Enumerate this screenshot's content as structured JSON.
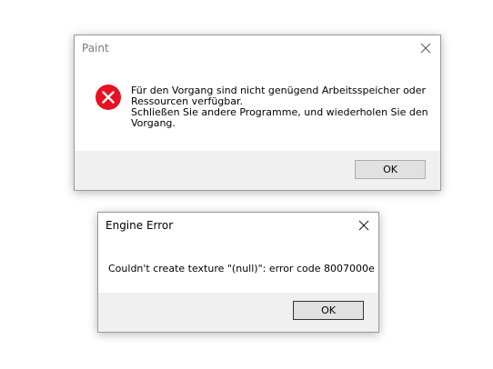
{
  "paint_dialog": {
    "title": "Paint",
    "message_lines": [
      "Für den Vorgang sind nicht genügend Arbeitsspeicher oder",
      "Ressourcen verfügbar.",
      "Schließen Sie andere Programme, und wiederholen Sie den",
      "Vorgang."
    ],
    "ok_label": "OK",
    "icon": "error-icon",
    "icon_color": "#e81123"
  },
  "engine_dialog": {
    "title": "Engine Error",
    "message": "Couldn't create texture \"(null)\": error code 8007000e",
    "ok_label": "OK"
  }
}
